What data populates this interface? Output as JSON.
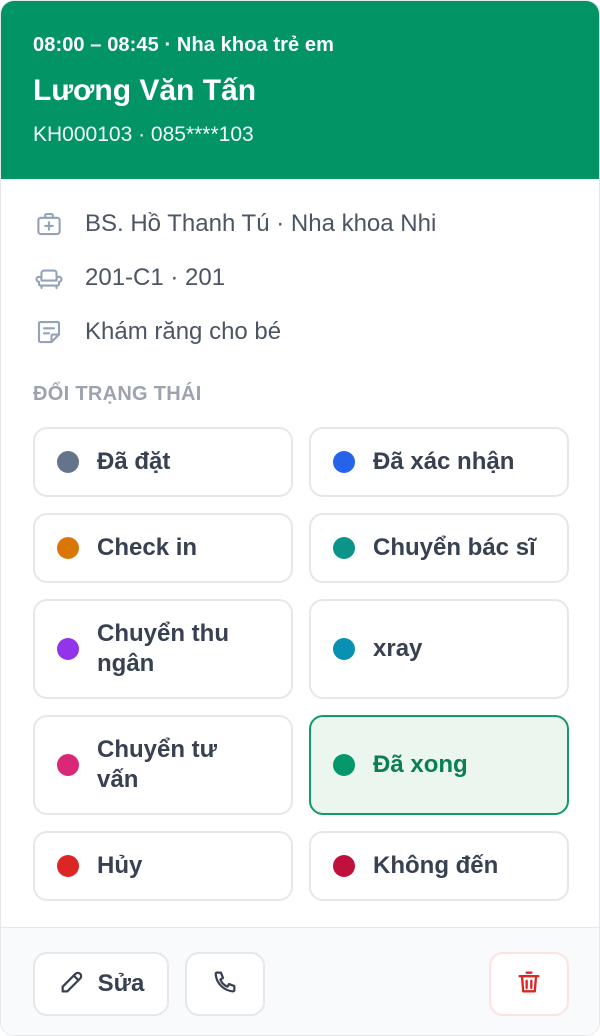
{
  "header": {
    "time_line": "08:00 – 08:45 · Nha khoa trẻ em",
    "patient_name": "Lương Văn Tấn",
    "code_line": "KH000103 · 085****103",
    "bg_color": "#039465"
  },
  "info": {
    "doctor": {
      "icon": "medical-kit-icon",
      "text": "BS. Hồ Thanh Tú · Nha khoa Nhi"
    },
    "chair": {
      "icon": "dental-chair-icon",
      "text": "201-C1 · 201"
    },
    "note": {
      "icon": "note-icon",
      "text": "Khám răng cho bé"
    }
  },
  "status_section_label": "ĐỔI TRẠNG THÁI",
  "statuses": [
    {
      "label": "Đã đặt",
      "color": "#64748b",
      "active": false
    },
    {
      "label": "Đã xác nhận",
      "color": "#2563eb",
      "active": false
    },
    {
      "label": "Check in",
      "color": "#d97706",
      "active": false
    },
    {
      "label": "Chuyển bác sĩ",
      "color": "#0d9488",
      "active": false
    },
    {
      "label": "Chuyển thu ngân",
      "color": "#9333ea",
      "active": false
    },
    {
      "label": "xray",
      "color": "#0891b2",
      "active": false
    },
    {
      "label": "Chuyển tư vấn",
      "color": "#db2777",
      "active": false
    },
    {
      "label": "Đã xong",
      "color": "#059669",
      "active": true
    },
    {
      "label": "Hủy",
      "color": "#dc2626",
      "active": false
    },
    {
      "label": "Không đến",
      "color": "#be123c",
      "active": false
    }
  ],
  "footer": {
    "edit_label": "Sửa",
    "edit_icon": "pencil-icon",
    "call_icon": "phone-icon",
    "delete_icon": "trash-icon",
    "delete_color": "#dc2626"
  }
}
